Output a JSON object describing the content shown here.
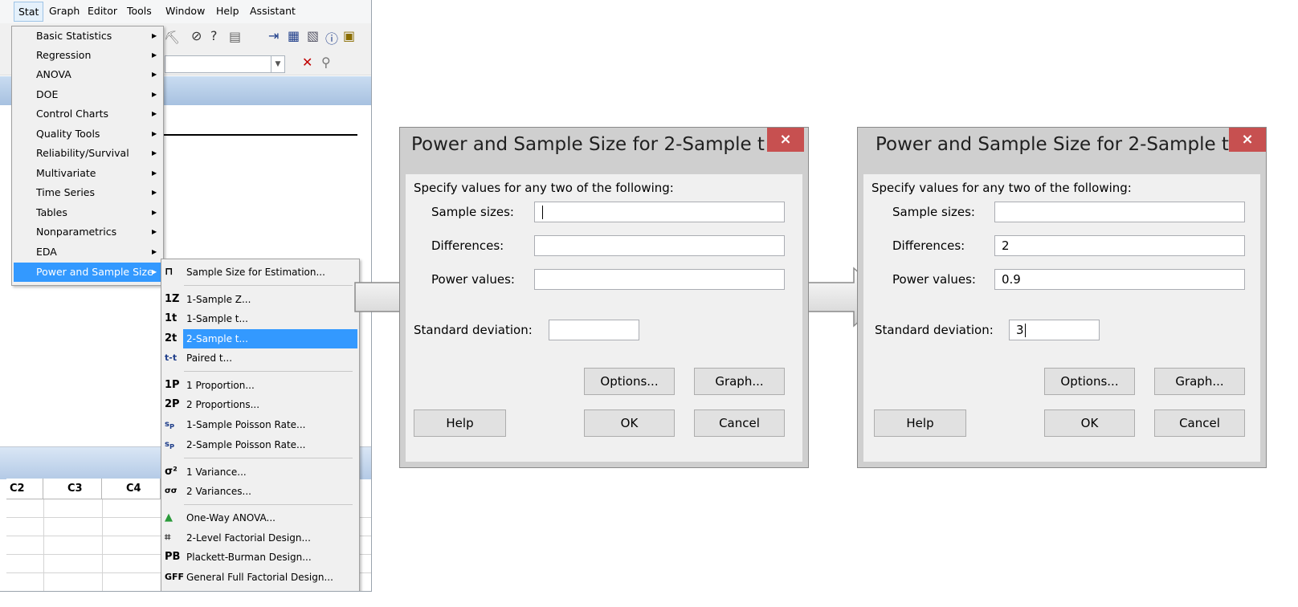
{
  "menubar": {
    "items": [
      "Stat",
      "Graph",
      "Editor",
      "Tools",
      "Window",
      "Help",
      "Assistant"
    ]
  },
  "stat_menu": {
    "items": [
      {
        "label": "Basic Statistics"
      },
      {
        "label": "Regression"
      },
      {
        "label": "ANOVA"
      },
      {
        "label": "DOE"
      },
      {
        "label": "Control Charts"
      },
      {
        "label": "Quality Tools"
      },
      {
        "label": "Reliability/Survival"
      },
      {
        "label": "Multivariate"
      },
      {
        "label": "Time Series"
      },
      {
        "label": "Tables"
      },
      {
        "label": "Nonparametrics"
      },
      {
        "label": "EDA"
      },
      {
        "label": "Power and Sample Size",
        "selected": true
      }
    ]
  },
  "power_submenu": {
    "items": [
      {
        "icon": "n",
        "label": "Sample Size for Estimation..."
      },
      {
        "icon": "1Z",
        "label": "1-Sample Z..."
      },
      {
        "icon": "1t",
        "label": "1-Sample t..."
      },
      {
        "icon": "2t",
        "label": "2-Sample t...",
        "selected": true
      },
      {
        "icon": "t-t",
        "label": "Paired t..."
      },
      {
        "icon": "1P",
        "label": "1 Proportion..."
      },
      {
        "icon": "2P",
        "label": "2 Proportions..."
      },
      {
        "icon": "sp1",
        "label": "1-Sample Poisson Rate..."
      },
      {
        "icon": "sp2",
        "label": "2-Sample Poisson Rate..."
      },
      {
        "icon": "σ²",
        "label": "1 Variance..."
      },
      {
        "icon": "σσ",
        "label": "2 Variances..."
      },
      {
        "icon": "anova",
        "label": "One-Way ANOVA..."
      },
      {
        "icon": "factorial",
        "label": "2-Level Factorial Design..."
      },
      {
        "icon": "PB",
        "label": "Plackett-Burman Design..."
      },
      {
        "icon": "GFF",
        "label": "General Full Factorial Design..."
      }
    ]
  },
  "worksheet": {
    "columns": [
      "C2",
      "C3",
      "C4"
    ]
  },
  "dialog_empty": {
    "title": "Power and Sample Size for 2-Sample t",
    "close": "×",
    "prompt": "Specify values for any two of the following:",
    "sample_sizes_label": "Sample sizes:",
    "sample_sizes_value": "",
    "differences_label": "Differences:",
    "differences_value": "",
    "power_values_label": "Power values:",
    "power_values_value": "",
    "std_dev_label": "Standard deviation:",
    "std_dev_value": "",
    "options_button": "Options...",
    "graph_button": "Graph...",
    "help_button": "Help",
    "ok_button": "OK",
    "cancel_button": "Cancel"
  },
  "dialog_filled": {
    "title": "Power and Sample Size for 2-Sample t",
    "close": "×",
    "prompt": "Specify values for any two of the following:",
    "sample_sizes_label": "Sample sizes:",
    "sample_sizes_value": "",
    "differences_label": "Differences:",
    "differences_value": "2",
    "power_values_label": "Power values:",
    "power_values_value": "0.9",
    "std_dev_label": "Standard deviation:",
    "std_dev_value": "3",
    "options_button": "Options...",
    "graph_button": "Graph...",
    "help_button": "Help",
    "ok_button": "OK",
    "cancel_button": "Cancel"
  },
  "colors": {
    "menu_highlight": "#3399ff",
    "close_button": "#c75050",
    "pane_title": "#b4cae6"
  }
}
